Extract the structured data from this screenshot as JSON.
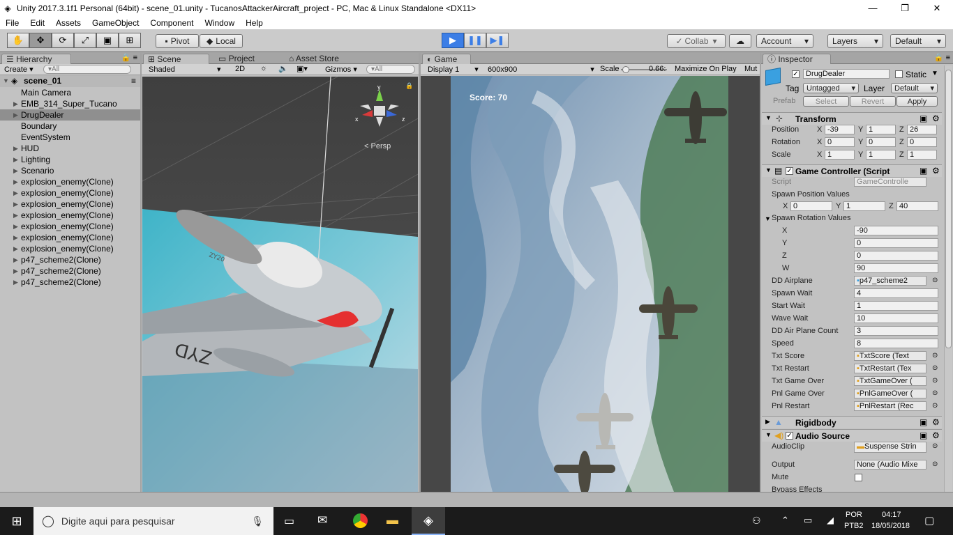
{
  "window": {
    "title": "Unity 2017.3.1f1 Personal (64bit) - scene_01.unity - TucanosAttackerAircraft_project - PC, Mac & Linux Standalone <DX11>",
    "minimize": "—",
    "maximize": "❐",
    "close": "✕"
  },
  "menu": [
    "File",
    "Edit",
    "Assets",
    "GameObject",
    "Component",
    "Window",
    "Help"
  ],
  "toolbar": {
    "pivot": "Pivot",
    "local": "Local",
    "collab": "Collab",
    "account": "Account",
    "layers": "Layers",
    "layout": "Default"
  },
  "hierarchy": {
    "tab": "Hierarchy",
    "create": "Create",
    "search_placeholder": "▾All",
    "scene": "scene_01",
    "items": [
      {
        "label": "Main Camera",
        "arrow": ""
      },
      {
        "label": "EMB_314_Super_Tucano",
        "arrow": "▶"
      },
      {
        "label": "DrugDealer",
        "arrow": "▶"
      },
      {
        "label": "Boundary",
        "arrow": ""
      },
      {
        "label": "EventSystem",
        "arrow": ""
      },
      {
        "label": "HUD",
        "arrow": "▶"
      },
      {
        "label": "Lighting",
        "arrow": "▶"
      },
      {
        "label": "Scenario",
        "arrow": "▶"
      },
      {
        "label": "explosion_enemy(Clone)",
        "arrow": "▶"
      },
      {
        "label": "explosion_enemy(Clone)",
        "arrow": "▶"
      },
      {
        "label": "explosion_enemy(Clone)",
        "arrow": "▶"
      },
      {
        "label": "explosion_enemy(Clone)",
        "arrow": "▶"
      },
      {
        "label": "explosion_enemy(Clone)",
        "arrow": "▶"
      },
      {
        "label": "explosion_enemy(Clone)",
        "arrow": "▶"
      },
      {
        "label": "explosion_enemy(Clone)",
        "arrow": "▶"
      },
      {
        "label": "p47_scheme2(Clone)",
        "arrow": "▶"
      },
      {
        "label": "p47_scheme2(Clone)",
        "arrow": "▶"
      },
      {
        "label": "p47_scheme2(Clone)",
        "arrow": "▶"
      }
    ]
  },
  "scene": {
    "tabs": [
      "Scene",
      "Project",
      "Asset Store"
    ],
    "shading": "Shaded",
    "mode2d": "2D",
    "gizmos": "Gizmos",
    "search": "▾All",
    "persp": "Persp",
    "axis_x": "x",
    "axis_y": "y",
    "axis_z": "z",
    "plane_tail": "ZYD",
    "plane_code": "ZY20"
  },
  "game": {
    "tab": "Game",
    "display": "Display 1",
    "resolution": "600x900",
    "scale_label": "Scale",
    "scale_value": "0.66:",
    "maximize": "Maximize On Play",
    "mute": "Mut",
    "score": "Score: 70"
  },
  "inspector": {
    "tab": "Inspector",
    "object_name": "DrugDealer",
    "static_label": "Static",
    "tag_label": "Tag",
    "tag_value": "Untagged",
    "layer_label": "Layer",
    "layer_value": "Default",
    "prefab_label": "Prefab",
    "select": "Select",
    "revert": "Revert",
    "apply": "Apply",
    "transform": {
      "title": "Transform",
      "position": {
        "label": "Position",
        "x": "-39",
        "y": "1",
        "z": "26"
      },
      "rotation": {
        "label": "Rotation",
        "x": "0",
        "y": "0",
        "z": "0"
      },
      "scale": {
        "label": "Scale",
        "x": "1",
        "y": "1",
        "z": "1"
      }
    },
    "controller": {
      "title": "Game Controller (Script",
      "script_label": "Script",
      "script_value": "GameControlle",
      "spawn_pos_label": "Spawn Position Values",
      "spawn_pos": {
        "x": "0",
        "y": "1",
        "z": "40"
      },
      "spawn_rot_label": "Spawn Rotation Values",
      "spawn_rot": [
        {
          "label": "X",
          "value": "-90"
        },
        {
          "label": "Y",
          "value": "0"
        },
        {
          "label": "Z",
          "value": "0"
        },
        {
          "label": "W",
          "value": "90"
        }
      ],
      "fields": [
        {
          "label": "DD Airplane",
          "value": "p47_scheme2",
          "obj": true
        },
        {
          "label": "Spawn Wait",
          "value": "4",
          "obj": false
        },
        {
          "label": "Start Wait",
          "value": "1",
          "obj": false
        },
        {
          "label": "Wave Wait",
          "value": "10",
          "obj": false
        },
        {
          "label": "DD Air Plane Count",
          "value": "3",
          "obj": false
        },
        {
          "label": "Speed",
          "value": "8",
          "obj": false
        },
        {
          "label": "Txt Score",
          "value": "TxtScore (Text",
          "obj": true
        },
        {
          "label": "Txt Restart",
          "value": "TxtRestart (Tex",
          "obj": true
        },
        {
          "label": "Txt Game Over",
          "value": "TxtGameOver (",
          "obj": true
        },
        {
          "label": "Pnl Game Over",
          "value": "PnlGameOver (",
          "obj": true
        },
        {
          "label": "Pnl Restart",
          "value": "PnlRestart (Rec",
          "obj": true
        }
      ]
    },
    "rigidbody": "Rigidbody",
    "audio": {
      "title": "Audio Source",
      "clip_label": "AudioClip",
      "clip_value": "Suspense Strin",
      "output_label": "Output",
      "output_value": "None (Audio Mixe",
      "mute_label": "Mute",
      "bypass_label": "Bypass Effects"
    }
  },
  "taskbar": {
    "search_placeholder": "Digite aqui para pesquisar",
    "lang": "POR",
    "layout": "PTB2",
    "time": "04:17",
    "date": "18/05/2018"
  }
}
